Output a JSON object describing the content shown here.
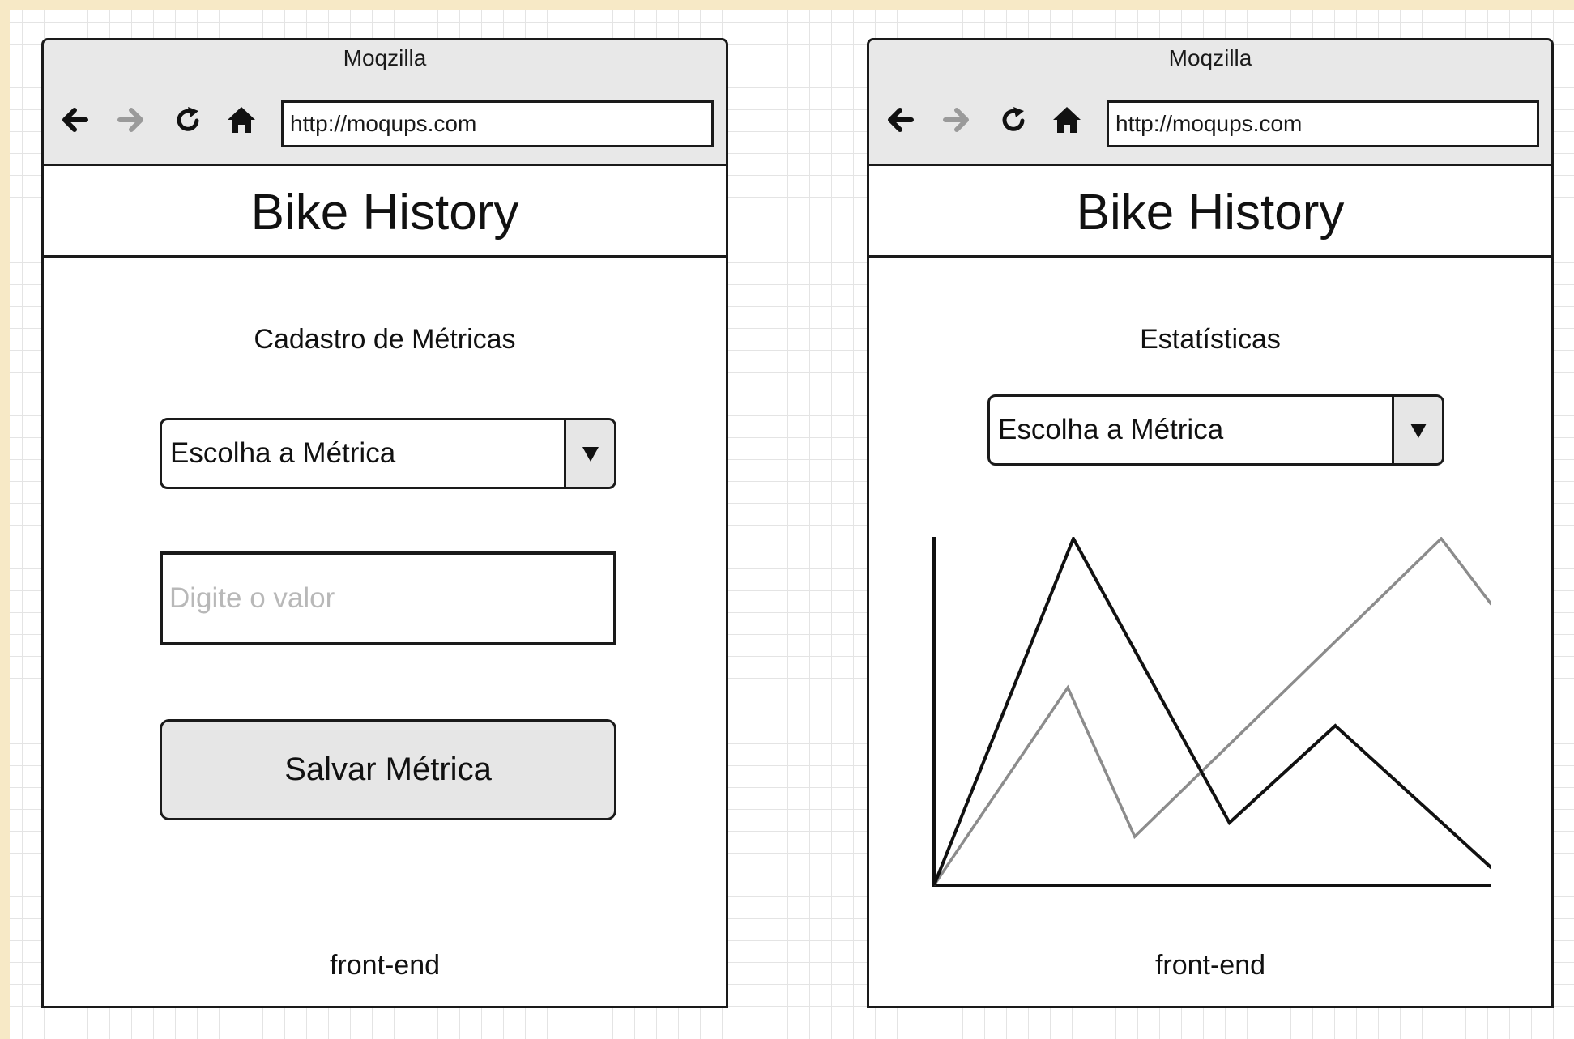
{
  "browser": {
    "title": "Moqzilla",
    "url": "http://moqups.com",
    "icons": [
      "back-arrow-icon",
      "forward-arrow-icon",
      "reload-icon",
      "home-icon"
    ]
  },
  "app": {
    "title": "Bike History"
  },
  "screens": {
    "register": {
      "section_title": "Cadastro de Métricas",
      "metric_select": {
        "selected": "Escolha a Métrica"
      },
      "value_input": {
        "placeholder": "Digite o valor",
        "value": ""
      },
      "save_button": {
        "label": "Salvar Métrica"
      },
      "footer": "front-end"
    },
    "stats": {
      "section_title": "Estatísticas",
      "metric_select": {
        "selected": "Escolha a Métrica"
      },
      "footer": "front-end"
    }
  },
  "colors": {
    "grid_line": "#e4e4e4",
    "chrome_bg": "#e8e8e8",
    "button_bg": "#e6e6e6",
    "series_dark": "#111111",
    "series_light": "#8c8c8c"
  },
  "chart_data": {
    "type": "line",
    "title": "",
    "xlabel": "",
    "ylabel": "",
    "xlim": [
      0,
      100
    ],
    "ylim": [
      0,
      100
    ],
    "grid": false,
    "series": [
      {
        "color": "#111111",
        "x": [
          0,
          25,
          53,
          72,
          100
        ],
        "y": [
          0,
          100,
          18,
          46,
          5
        ]
      },
      {
        "color": "#8c8c8c",
        "x": [
          0,
          24,
          36,
          91,
          100
        ],
        "y": [
          0,
          57,
          14,
          100,
          81
        ]
      }
    ]
  }
}
